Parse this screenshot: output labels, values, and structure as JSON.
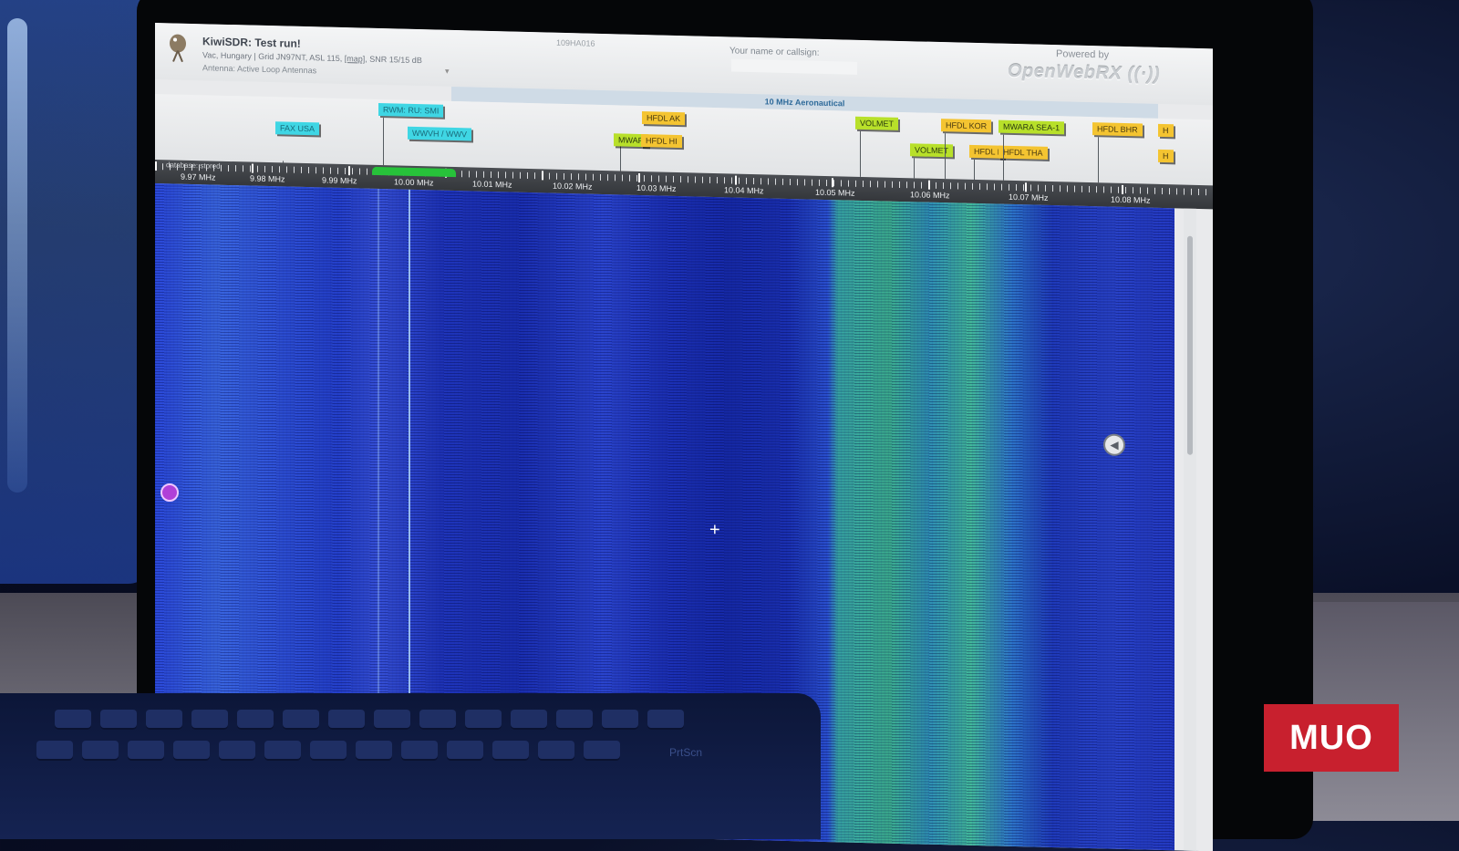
{
  "header": {
    "title": "KiwiSDR: Test run!",
    "location_prefix": "Vac, Hungary | Grid JN97NT, ASL 115,",
    "map_link": "[map]",
    "snr": ", SNR 15/15 dB",
    "antenna": "Antenna: Active Loop Antennas",
    "center_id": "109HA016",
    "callsign_label": "Your name or callsign:",
    "callsign_value": "",
    "powered_by": "Powered by",
    "brand": "OpenWebRX"
  },
  "band": {
    "label": "10 MHz Aeronautical"
  },
  "bookmarks": [
    {
      "label": "FAX USA",
      "color": "cyan"
    },
    {
      "label": "RWM: RU: SMI",
      "color": "cyan"
    },
    {
      "label": "WWVH / WWV",
      "color": "cyan"
    },
    {
      "label": "HFDL AK",
      "color": "yellow"
    },
    {
      "label": "MWAR",
      "color": "green"
    },
    {
      "label": "HFDL HI",
      "color": "yellow"
    },
    {
      "label": "VOLMET",
      "color": "green"
    },
    {
      "label": "VOLMET",
      "color": "green"
    },
    {
      "label": "HFDL KOR",
      "color": "yellow"
    },
    {
      "label": "HFDL I",
      "color": "yellow"
    },
    {
      "label": "HFDL THA",
      "color": "yellow"
    },
    {
      "label": "MWARA SEA-1",
      "color": "green"
    },
    {
      "label": "HFDL BHR",
      "color": "yellow"
    },
    {
      "label": "H",
      "color": "yellow"
    },
    {
      "label": "H",
      "color": "yellow"
    }
  ],
  "scale": {
    "db_label": "database: stored",
    "ticks": [
      "9.97 MHz",
      "9.98 MHz",
      "9.99 MHz",
      "10.00 MHz",
      "10.01 MHz",
      "10.02 MHz",
      "10.03 MHz",
      "10.04 MHz",
      "10.05 MHz",
      "10.06 MHz",
      "10.07 MHz",
      "10.08 MHz"
    ]
  },
  "keyboard": {
    "prtsc_label": "PrtScn"
  },
  "watermark": "MUO",
  "colors": {
    "waterfall_base": "#2440c9",
    "passband": "#27c23a",
    "watermark_bg": "#c8202e"
  }
}
